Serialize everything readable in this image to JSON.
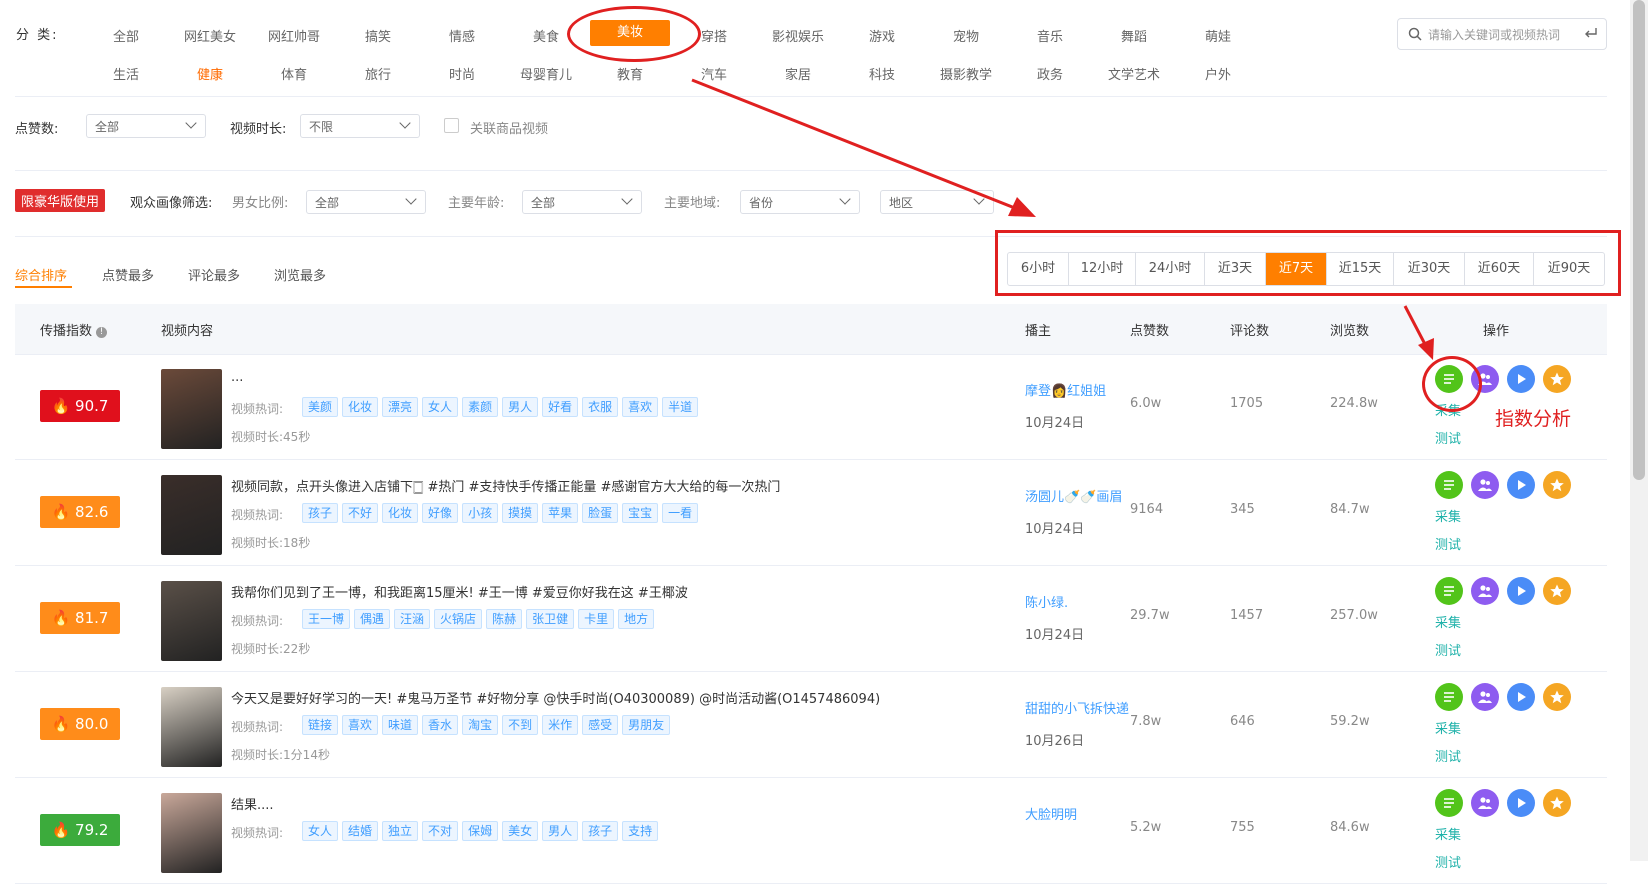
{
  "category": {
    "label": "分 类:",
    "row1": [
      "全部",
      "网红美女",
      "网红帅哥",
      "搞笑",
      "情感",
      "美食",
      "美妆",
      "穿搭",
      "影视娱乐",
      "游戏",
      "宠物",
      "音乐",
      "舞蹈",
      "萌娃"
    ],
    "row2": [
      "生活",
      "健康",
      "体育",
      "旅行",
      "时尚",
      "母婴育儿",
      "教育",
      "汽车",
      "家居",
      "科技",
      "摄影教学",
      "政务",
      "文学艺术",
      "户外"
    ],
    "selected": "美妆",
    "highlighted": "健康"
  },
  "search": {
    "placeholder": "请输入关键词或视频热词"
  },
  "filters": {
    "likes_label": "点赞数:",
    "likes_value": "全部",
    "duration_label": "视频时长:",
    "duration_value": "不限",
    "goods_label": "关联商品视频",
    "premium_badge": "限豪华版使用",
    "audience_label": "观众画像筛选:",
    "gender_label": "男女比例:",
    "gender_value": "全部",
    "age_label": "主要年龄:",
    "age_value": "全部",
    "region_label": "主要地域:",
    "province_value": "省份",
    "district_value": "地区"
  },
  "sort_tabs": [
    "综合排序",
    "点赞最多",
    "评论最多",
    "浏览最多"
  ],
  "time_ranges": [
    "6小时",
    "12小时",
    "24小时",
    "近3天",
    "近7天",
    "近15天",
    "近30天",
    "近60天",
    "近90天"
  ],
  "time_selected": "近7天",
  "table": {
    "headers": {
      "index": "传播指数",
      "content": "视频内容",
      "author": "播主",
      "likes": "点赞数",
      "comments": "评论数",
      "views": "浏览数",
      "ops": "操作"
    },
    "tags_label": "视频热词:",
    "duration_prefix": "视频时长:",
    "op_collect": "采集",
    "op_test": "测试",
    "rows": [
      {
        "score": "90.7",
        "score_color": "#e0101c",
        "title": "...",
        "tags": [
          "美颜",
          "化妆",
          "漂亮",
          "女人",
          "素颜",
          "男人",
          "好看",
          "衣服",
          "喜欢",
          "半道"
        ],
        "duration": "45秒",
        "author": "摩登👩红姐姐",
        "date": "10月24日",
        "likes": "6.0w",
        "comments": "1705",
        "views": "224.8w"
      },
      {
        "score": "82.6",
        "score_color": "#ff8c1a",
        "title": "视频同款，点开头像进入店铺下🀆 #热门 #支持快手传播正能量 #感谢官方大大给的每一次热门",
        "tags": [
          "孩子",
          "不好",
          "化妆",
          "好像",
          "小孩",
          "摸摸",
          "苹果",
          "脸蛋",
          "宝宝",
          "一看"
        ],
        "duration": "18秒",
        "author": "汤圆儿🍼🍼画眉",
        "date": "10月24日",
        "likes": "9164",
        "comments": "345",
        "views": "84.7w"
      },
      {
        "score": "81.7",
        "score_color": "#ff8c1a",
        "title": "我帮你们见到了王一博，和我距离15厘米! #王一博 #爱豆你好我在这 #王椰波",
        "tags": [
          "王一博",
          "偶遇",
          "汪涵",
          "火锅店",
          "陈赫",
          "张卫健",
          "卡里",
          "地方"
        ],
        "duration": "22秒",
        "author": "陈小绿.",
        "date": "10月24日",
        "likes": "29.7w",
        "comments": "1457",
        "views": "257.0w"
      },
      {
        "score": "80.0",
        "score_color": "#ff8c1a",
        "title": "今天又是要好好学习的一天!  #鬼马万圣节 #好物分享 @快手时尚(O40300089) @时尚活动酱(O1457486094)",
        "tags": [
          "链接",
          "喜欢",
          "味道",
          "香水",
          "淘宝",
          "不到",
          "米作",
          "感受",
          "男朋友"
        ],
        "duration": "1分14秒",
        "author": "甜甜的小飞拆快递",
        "date": "10月26日",
        "likes": "7.8w",
        "comments": "646",
        "views": "59.2w"
      },
      {
        "score": "79.2",
        "score_color": "#3cab3c",
        "title": "结果....",
        "tags": [
          "女人",
          "结婚",
          "独立",
          "不对",
          "保姆",
          "美女",
          "男人",
          "孩子",
          "支持"
        ],
        "duration": "",
        "author": "大脸明明",
        "date": "",
        "likes": "5.2w",
        "comments": "755",
        "views": "84.6w"
      }
    ]
  },
  "annotation": {
    "text": "指数分析"
  },
  "colors": {
    "accent": "#ff7f00",
    "annot": "#e02020",
    "green": "#52c41a",
    "purple": "#8e5cf0",
    "blue": "#4a8cf7",
    "orange": "#f5a623"
  }
}
